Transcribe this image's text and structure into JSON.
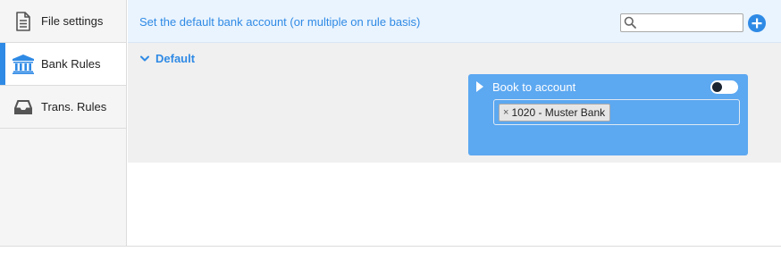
{
  "sidebar": {
    "items": [
      {
        "label": "File settings",
        "icon": "file-settings-icon",
        "active": false
      },
      {
        "label": "Bank Rules",
        "icon": "bank-icon",
        "active": true
      },
      {
        "label": "Trans. Rules",
        "icon": "inbox-tray-icon",
        "active": false
      }
    ]
  },
  "header": {
    "description": "Set the default bank account (or multiple on rule basis)",
    "search": {
      "value": "",
      "placeholder": ""
    }
  },
  "group": {
    "title": "Default",
    "rule": {
      "title": "Book to account",
      "toggle_on": false,
      "tags": [
        "1020 - Muster Bank"
      ],
      "tag_remove_glyph": "×"
    }
  },
  "colors": {
    "accent": "#2f8ae5",
    "card": "#5ca8f1",
    "header_bg": "#eaf4fe",
    "content_bg": "#f0f0f0"
  }
}
